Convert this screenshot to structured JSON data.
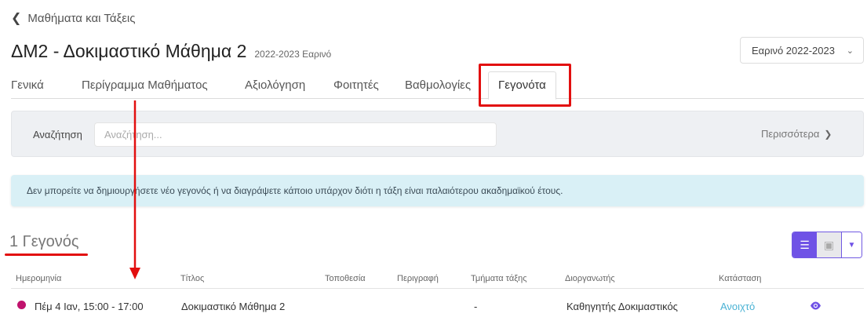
{
  "breadcrumb": {
    "back_label": "Μαθήματα και Τάξεις"
  },
  "header": {
    "title": "ΔΜ2 - Δοκιμαστικό Μάθημα 2",
    "subtitle": "2022-2023 Εαρινό",
    "semester_select": "Εαρινό 2022-2023"
  },
  "tabs": [
    {
      "label": "Γενικά"
    },
    {
      "label": "Περίγραμμα Μαθήματος"
    },
    {
      "label": "Αξιολόγηση"
    },
    {
      "label": "Φοιτητές"
    },
    {
      "label": "Βαθμολογίες"
    },
    {
      "label": "Γεγονότα",
      "active": true
    }
  ],
  "search": {
    "label": "Αναζήτηση",
    "placeholder": "Αναζήτηση...",
    "more_label": "Περισσότερα"
  },
  "alert": {
    "text": "Δεν μπορείτε να δημιουργήσετε νέο γεγονός ή να διαγράψετε κάποιο υπάρχον διότι η τάξη είναι παλαιότερου ακαδημαϊκού έτους."
  },
  "events": {
    "count_label": "1 Γεγονός",
    "columns": [
      "Ημερομηνία",
      "Τίτλος",
      "Τοποθεσία",
      "Περιγραφή",
      "Τμήματα τάξης",
      "Διοργανωτής",
      "Κατάσταση"
    ],
    "rows": [
      {
        "date": "Πέμ 4 Ιαν, 15:00 - 17:00",
        "title": "Δοκιμαστικό Μάθημα 2",
        "location": "",
        "description": "",
        "sections": "-",
        "organizer": "Καθηγητής Δοκιμαστικός",
        "status": "Ανοιχτό"
      }
    ]
  },
  "colors": {
    "accent": "#6f52e6",
    "annotation_red": "#e20f0f",
    "event_dot": "#c0136d",
    "status_link": "#4ab2d4",
    "alert_bg": "#d9f0f6"
  }
}
